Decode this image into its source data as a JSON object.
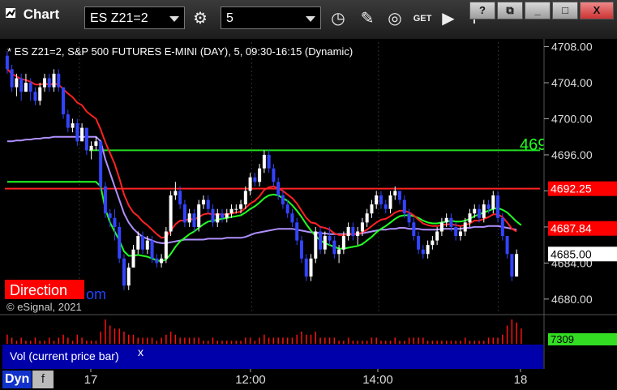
{
  "toolbar": {
    "app_title": "Chart",
    "symbol": "ES Z21=2",
    "interval": "5",
    "get_label": "GET"
  },
  "window_buttons": [
    "?",
    "⧉",
    "_",
    "□",
    "X"
  ],
  "study": {
    "header": "* ES Z21=2, S&P 500 FUTURES E-MINI (DAY), 5, 09:30-16:15 (Dynamic)",
    "copyright": "© eSignal, 2021",
    "direction_label": "Direction",
    "direction_suffix": "om",
    "partial_label": "469"
  },
  "price_axis": {
    "ticks": [
      "4708.00",
      "4704.00",
      "4700.00",
      "4696.00",
      "4692.00",
      "4688.00",
      "4684.00",
      "4680.00"
    ],
    "flags": [
      {
        "text": "4692.25",
        "bg": "#ff0000",
        "fg": "#ffffff"
      },
      {
        "text": "4687.84",
        "bg": "#ff0000",
        "fg": "#ffffff"
      },
      {
        "text": "4685.00",
        "bg": "#ffffff",
        "fg": "#000000"
      }
    ]
  },
  "volume": {
    "label": "Vol (current price bar)",
    "close_label": "x",
    "value": "7309"
  },
  "time_axis": {
    "ticks": [
      "17",
      "12:00",
      "14:00",
      "18"
    ],
    "interval_label": "Dyn",
    "interval_button": "f"
  },
  "colors": {
    "bar": "#3344ff",
    "mavg_red": "#ff2222",
    "mavg_green": "#22ff22",
    "mavg_purple": "#b090ff",
    "level_green": "#22dd22",
    "level_red": "#ff2222",
    "volume": "#ff1111",
    "volume_panel": "#0000aa"
  },
  "chart_data": {
    "type": "candlestick",
    "y_min": 4679,
    "y_max": 4708.5,
    "levels": [
      4696.5,
      4692.25
    ],
    "bars": [
      [
        4707,
        4707.5,
        4705,
        4705.5
      ],
      [
        4705.5,
        4706,
        4703,
        4703.5
      ],
      [
        4703.5,
        4705,
        4702.5,
        4704.5
      ],
      [
        4704.5,
        4705,
        4702,
        4703
      ],
      [
        4703,
        4705,
        4703,
        4704
      ],
      [
        4704,
        4704.5,
        4702,
        4703
      ],
      [
        4703,
        4703.5,
        4701.5,
        4702
      ],
      [
        4702,
        4704,
        4701.5,
        4703.5
      ],
      [
        4703.5,
        4705,
        4703,
        4704.5
      ],
      [
        4704.5,
        4705,
        4703,
        4703.5
      ],
      [
        4703.5,
        4705.5,
        4703,
        4705
      ],
      [
        4705,
        4705.5,
        4703,
        4703.5
      ],
      [
        4703.5,
        4703.5,
        4700,
        4700.5
      ],
      [
        4700.5,
        4701,
        4698.5,
        4699
      ],
      [
        4699,
        4700,
        4698.5,
        4699.5
      ],
      [
        4699.5,
        4700,
        4697,
        4697.5
      ],
      [
        4697.5,
        4699.5,
        4697.5,
        4699
      ],
      [
        4699,
        4699,
        4696,
        4696.5
      ],
      [
        4696.5,
        4697.5,
        4695.5,
        4697
      ],
      [
        4697,
        4698,
        4696.5,
        4697.5
      ],
      [
        4697.5,
        4697.5,
        4692,
        4692.5
      ],
      [
        4692.5,
        4693,
        4689,
        4689.5
      ],
      [
        4689.5,
        4690,
        4688,
        4689
      ],
      [
        4689,
        4690,
        4686.5,
        4688
      ],
      [
        4688,
        4688.5,
        4684,
        4684.5
      ],
      [
        4684.5,
        4685,
        4681,
        4681.5
      ],
      [
        4681.5,
        4684,
        4681,
        4683.5
      ],
      [
        4683.5,
        4686,
        4683.5,
        4685.5
      ],
      [
        4685.5,
        4687.5,
        4685,
        4687
      ],
      [
        4687,
        4687.5,
        4685,
        4685.5
      ],
      [
        4685.5,
        4687,
        4685,
        4686.5
      ],
      [
        4686.5,
        4687,
        4684,
        4684.5
      ],
      [
        4684.5,
        4685,
        4683.5,
        4684
      ],
      [
        4684,
        4685,
        4683.5,
        4684.5
      ],
      [
        4684.5,
        4688,
        4684,
        4687.5
      ],
      [
        4687.5,
        4692,
        4687,
        4691.5
      ],
      [
        4691.5,
        4693,
        4691,
        4692
      ],
      [
        4692,
        4692.5,
        4690,
        4690.5
      ],
      [
        4690.5,
        4691,
        4688,
        4688.5
      ],
      [
        4688.5,
        4690,
        4688,
        4689.5
      ],
      [
        4689.5,
        4690,
        4687.5,
        4688
      ],
      [
        4688,
        4691,
        4687.5,
        4690.5
      ],
      [
        4690.5,
        4691.5,
        4690,
        4691
      ],
      [
        4691,
        4691.5,
        4689.5,
        4690
      ],
      [
        4690,
        4690.5,
        4688,
        4688.5
      ],
      [
        4688.5,
        4690,
        4688,
        4689.5
      ],
      [
        4689.5,
        4690,
        4688.5,
        4689
      ],
      [
        4689,
        4690,
        4688.5,
        4689.5
      ],
      [
        4689.5,
        4690.5,
        4689,
        4690
      ],
      [
        4690,
        4690.5,
        4689.5,
        4690
      ],
      [
        4690,
        4691,
        4689.5,
        4690.5
      ],
      [
        4690.5,
        4692.5,
        4690,
        4692
      ],
      [
        4692,
        4694,
        4691.5,
        4693.5
      ],
      [
        4693.5,
        4694,
        4692.5,
        4693
      ],
      [
        4693,
        4695,
        4692.5,
        4694.5
      ],
      [
        4694.5,
        4696.5,
        4694,
        4696
      ],
      [
        4696,
        4696.5,
        4694,
        4694.5
      ],
      [
        4694.5,
        4695,
        4692.5,
        4693
      ],
      [
        4693,
        4693.5,
        4691,
        4691.5
      ],
      [
        4691.5,
        4692,
        4690,
        4690.5
      ],
      [
        4690.5,
        4691,
        4689,
        4689.5
      ],
      [
        4689.5,
        4690,
        4688,
        4688.5
      ],
      [
        4688.5,
        4689,
        4686,
        4686.5
      ],
      [
        4686.5,
        4687,
        4684,
        4684.5
      ],
      [
        4684.5,
        4685,
        4682,
        4682.5
      ],
      [
        4682.5,
        4685,
        4682,
        4684.5
      ],
      [
        4684.5,
        4688,
        4684,
        4687.5
      ],
      [
        4687.5,
        4688,
        4685,
        4685.5
      ],
      [
        4685.5,
        4687.5,
        4685,
        4687
      ],
      [
        4687,
        4688,
        4686,
        4686.5
      ],
      [
        4686.5,
        4687,
        4684.5,
        4685
      ],
      [
        4685,
        4686,
        4684,
        4685.5
      ],
      [
        4685.5,
        4687.5,
        4685,
        4687
      ],
      [
        4687,
        4688.5,
        4686.5,
        4688
      ],
      [
        4688,
        4688.5,
        4686.5,
        4687
      ],
      [
        4687,
        4688,
        4686,
        4687.5
      ],
      [
        4687.5,
        4689,
        4687,
        4688.5
      ],
      [
        4688.5,
        4690,
        4688,
        4689.5
      ],
      [
        4689.5,
        4691,
        4689,
        4690.5
      ],
      [
        4690.5,
        4692,
        4690,
        4691.5
      ],
      [
        4691.5,
        4692,
        4690,
        4690.5
      ],
      [
        4690.5,
        4691,
        4689.5,
        4690
      ],
      [
        4690,
        4692,
        4689.5,
        4691.5
      ],
      [
        4691.5,
        4692.5,
        4691,
        4692
      ],
      [
        4692,
        4692,
        4690.5,
        4691
      ],
      [
        4691,
        4691.5,
        4689,
        4689.5
      ],
      [
        4689.5,
        4690,
        4688,
        4688.5
      ],
      [
        4688.5,
        4689,
        4686.5,
        4687
      ],
      [
        4687,
        4687.5,
        4685,
        4685.5
      ],
      [
        4685.5,
        4686,
        4684.5,
        4685
      ],
      [
        4685,
        4686.5,
        4684.5,
        4686
      ],
      [
        4686,
        4687,
        4685.5,
        4686.5
      ],
      [
        4686.5,
        4688,
        4686,
        4687.5
      ],
      [
        4687.5,
        4689,
        4687,
        4688.5
      ],
      [
        4688.5,
        4689.5,
        4688,
        4689
      ],
      [
        4689,
        4689.5,
        4687.5,
        4688
      ],
      [
        4688,
        4688.5,
        4686.5,
        4687
      ],
      [
        4687,
        4688,
        4686.5,
        4687.5
      ],
      [
        4687.5,
        4689,
        4687,
        4688.5
      ],
      [
        4688.5,
        4690,
        4688,
        4689.5
      ],
      [
        4689.5,
        4690.5,
        4689,
        4690
      ],
      [
        4690,
        4690.5,
        4688.5,
        4689
      ],
      [
        4689,
        4691,
        4688.5,
        4690.5
      ],
      [
        4690.5,
        4691,
        4689.5,
        4690
      ],
      [
        4690,
        4692,
        4689.5,
        4691.5
      ],
      [
        4691.5,
        4692,
        4688.5,
        4689
      ],
      [
        4689,
        4689.5,
        4686.5,
        4687
      ],
      [
        4687,
        4687,
        4684.5,
        4685
      ],
      [
        4685,
        4685,
        4682,
        4682.5
      ],
      [
        4682.5,
        4685.5,
        4682.5,
        4685
      ]
    ],
    "ma_red": [
      4705.5,
      4705,
      4704.7,
      4704.4,
      4704.3,
      4704.1,
      4703.8,
      4703.8,
      4703.9,
      4703.8,
      4703.9,
      4703.8,
      4703.3,
      4702.8,
      4702.4,
      4701.8,
      4701.5,
      4700.8,
      4700.4,
      4700,
      4698.8,
      4697.4,
      4696.2,
      4695,
      4693.4,
      4691.6,
      4690.4,
      4689.6,
      4689.2,
      4688.6,
      4688.2,
      4687.7,
      4687.2,
      4686.8,
      4686.9,
      4687.6,
      4688.3,
      4688.7,
      4688.7,
      4688.9,
      4688.8,
      4689.1,
      4689.4,
      4689.5,
      4689.4,
      4689.4,
      4689.4,
      4689.4,
      4689.5,
      4689.6,
      4689.7,
      4690.1,
      4690.6,
      4690.9,
      4691.4,
      4692.1,
      4692.4,
      4692.5,
      4692.3,
      4692,
      4691.6,
      4691.2,
      4690.6,
      4689.8,
      4689,
      4688.5,
      4688.4,
      4688,
      4687.9,
      4687.7,
      4687.3,
      4687.1,
      4687.1,
      4687.2,
      4687.2,
      4687.2,
      4687.4,
      4687.7,
      4688.1,
      4688.5,
      4688.8,
      4688.9,
      4689.2,
      4689.6,
      4689.8,
      4689.8,
      4689.6,
      4689.3,
      4688.8,
      4688.4,
      4688.2,
      4688.1,
      4688.1,
      4688.2,
      4688.3,
      4688.3,
      4688.2,
      4688.1,
      4688.2,
      4688.4,
      4688.7,
      4688.7,
      4688.9,
      4689.1,
      4689.4,
      4689.4,
      4689.1,
      4688.5,
      4687.8,
      4687.5
    ],
    "ma_green": [
      4693,
      4693,
      4693,
      4693,
      4693,
      4693,
      4693,
      4693,
      4693,
      4693,
      4693,
      4693,
      4693,
      4693,
      4693,
      4693,
      4693,
      4693,
      4693,
      4693,
      4692.5,
      4690,
      4688.5,
      4687.5,
      4686.5,
      4685.3,
      4684.8,
      4684.8,
      4684.9,
      4684.8,
      4684.7,
      4684.5,
      4684.3,
      4684.2,
      4684.4,
      4685,
      4685.8,
      4686.4,
      4686.8,
      4687.2,
      4687.5,
      4687.9,
      4688.3,
      4688.6,
      4688.7,
      4688.8,
      4688.9,
      4689,
      4689.1,
      4689.2,
      4689.3,
      4689.6,
      4690,
      4690.3,
      4690.7,
      4691.2,
      4691.5,
      4691.6,
      4691.5,
      4691.2,
      4690.9,
      4690.4,
      4689.8,
      4689.1,
      4688.3,
      4687.6,
      4687,
      4686.5,
      4686.2,
      4686,
      4685.8,
      4685.6,
      4685.6,
      4685.7,
      4685.8,
      4685.9,
      4686.1,
      4686.5,
      4686.9,
      4687.4,
      4687.8,
      4688.1,
      4688.5,
      4688.9,
      4689.2,
      4689.3,
      4689.3,
      4689.2,
      4689,
      4688.7,
      4688.5,
      4688.4,
      4688.4,
      4688.5,
      4688.6,
      4688.7,
      4688.6,
      4688.6,
      4688.7,
      4688.9,
      4689.2,
      4689.4,
      4689.6,
      4689.8,
      4690,
      4690.1,
      4689.9,
      4689.6,
      4689.1,
      4688.6,
      4688.2
    ],
    "ma_purple": [
      4697.5,
      4697.5,
      4697.6,
      4697.6,
      4697.7,
      4697.7,
      4697.8,
      4697.8,
      4697.9,
      4697.9,
      4698,
      4698,
      4698,
      4698,
      4698,
      4698,
      4698,
      4698,
      4698,
      4698,
      4697.5,
      4695.5,
      4694,
      4692.5,
      4691,
      4689.5,
      4688.5,
      4687.8,
      4687.3,
      4686.9,
      4686.7,
      4686.5,
      4686.3,
      4686.2,
      4686.2,
      4686.3,
      4686.4,
      4686.5,
      4686.6,
      4686.6,
      4686.6,
      4686.6,
      4686.6,
      4686.7,
      4686.7,
      4686.7,
      4686.7,
      4686.8,
      4686.8,
      4686.8,
      4686.8,
      4686.9,
      4687.1,
      4687.3,
      4687.4,
      4687.5,
      4687.6,
      4687.7,
      4687.8,
      4687.8,
      4687.8,
      4687.8,
      4687.7,
      4687.6,
      4687.5,
      4687.4,
      4687.4,
      4687.3,
      4687.3,
      4687.2,
      4687.2,
      4687.2,
      4687.2,
      4687.2,
      4687.2,
      4687.2,
      4687.3,
      4687.4,
      4687.5,
      4687.6,
      4687.7,
      4687.7,
      4687.8,
      4687.8,
      4687.9,
      4687.9,
      4687.8,
      4687.8,
      4687.8,
      4687.7,
      4687.7,
      4687.7,
      4687.7,
      4687.8,
      4687.8,
      4687.8,
      4687.8,
      4687.8,
      4687.9,
      4687.9,
      4688,
      4688,
      4688,
      4688.1,
      4688.1,
      4688.1,
      4688,
      4687.9,
      4687.8,
      4687.7
    ],
    "volume": [
      3,
      2,
      1,
      2,
      1,
      1,
      2,
      1,
      1,
      2,
      1,
      2,
      3,
      2,
      1,
      3,
      2,
      1,
      1,
      1,
      4,
      8,
      6,
      5,
      5,
      4,
      3,
      3,
      2,
      2,
      2,
      2,
      1,
      2,
      3,
      4,
      3,
      2,
      2,
      2,
      2,
      2,
      1,
      1,
      2,
      1,
      1,
      1,
      1,
      1,
      1,
      2,
      2,
      1,
      2,
      3,
      2,
      2,
      2,
      2,
      2,
      2,
      3,
      4,
      3,
      3,
      4,
      2,
      2,
      2,
      2,
      1,
      1,
      2,
      1,
      1,
      1,
      1,
      2,
      2,
      1,
      1,
      1,
      2,
      1,
      1,
      2,
      2,
      2,
      2,
      1,
      1,
      1,
      1,
      1,
      1,
      1,
      1,
      2,
      1,
      1,
      1,
      1,
      2,
      2,
      2,
      3,
      6,
      8,
      7,
      5
    ]
  }
}
